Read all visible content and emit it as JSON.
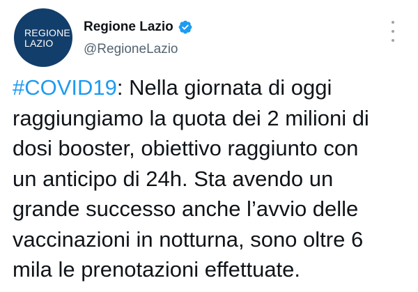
{
  "tweet": {
    "author": {
      "avatar_lines": [
        "REGIONE",
        "LAZIO"
      ],
      "display_name": "Regione Lazio",
      "handle": "@RegioneLazio",
      "verified": true,
      "verified_color": "#1d9bf0",
      "avatar_color": "#123e6b"
    },
    "more_icon": "more-vertical-icon",
    "body": {
      "hashtag": "#COVID19",
      "line1_rest": ": Nella giornata di oggi",
      "line2": "raggiungiamo la quota dei 2 milioni di",
      "line3": "dosi booster, obiettivo raggiunto con",
      "line4": "un anticipo di 24h. Sta avendo un",
      "line5": "grande successo anche l’avvio delle",
      "line6": "vaccinazioni in notturna, sono oltre 6",
      "line7": "mila le prenotazioni effettuate."
    },
    "hashtag_color": "#1d9bf0",
    "text_color": "#0f1419",
    "secondary_color": "#536471"
  }
}
